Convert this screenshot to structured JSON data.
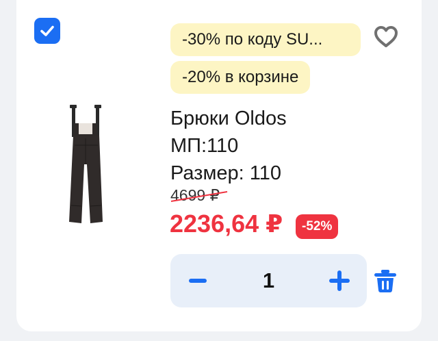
{
  "promos": [
    {
      "label": "-30% по коду SU..."
    },
    {
      "label": "-20% в корзине"
    }
  ],
  "product": {
    "title": "Брюки Oldos",
    "attributes": [
      {
        "text": "МП:110"
      },
      {
        "text": "Размер: 110"
      }
    ],
    "old_price": "4699 ₽",
    "price": "2236,64 ₽",
    "discount": "-52%"
  },
  "quantity": {
    "value": "1"
  },
  "icons": {
    "checkbox": "checkbox-checked-icon",
    "favorite": "heart-icon",
    "minus": "minus-icon",
    "plus": "plus-icon",
    "delete": "trash-icon"
  },
  "colors": {
    "accent_blue": "#1b6ef3",
    "price_red": "#ef3340",
    "promo_bg": "#fdf5c4",
    "stepper_bg": "#e8eff9",
    "page_bg": "#f0f2f5"
  }
}
